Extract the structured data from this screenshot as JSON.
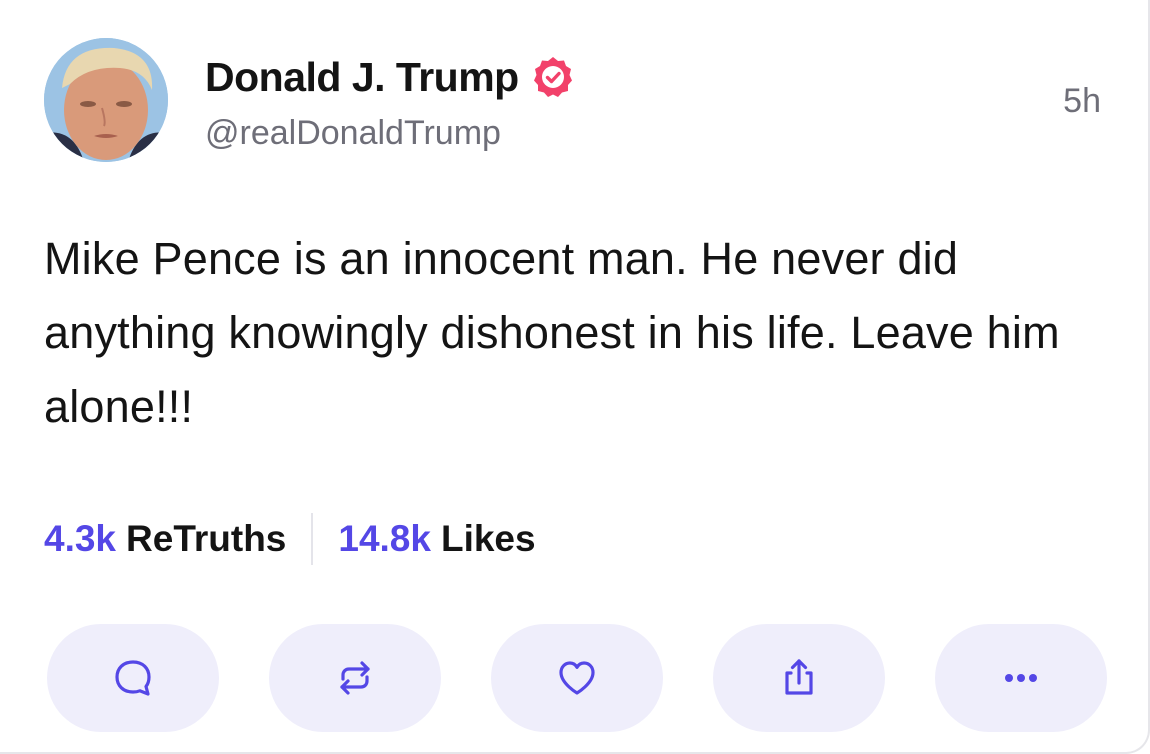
{
  "post": {
    "author": {
      "display_name": "Donald J. Trump",
      "handle": "@realDonaldTrump",
      "verified": true,
      "avatar_icon": "profile-photo"
    },
    "timestamp": "5h",
    "text": "Mike Pence is an innocent man. He never did anything knowingly dishonest in his life. Leave him alone!!!",
    "stats": {
      "retruths_count": "4.3k",
      "retruths_label": "ReTruths",
      "likes_count": "14.8k",
      "likes_label": "Likes"
    },
    "actions": [
      {
        "name": "reply",
        "icon": "speech-bubble-icon"
      },
      {
        "name": "retruth",
        "icon": "repost-arrows-icon"
      },
      {
        "name": "like",
        "icon": "heart-icon"
      },
      {
        "name": "share",
        "icon": "share-upload-icon"
      },
      {
        "name": "more",
        "icon": "ellipsis-icon"
      }
    ]
  },
  "colors": {
    "accent": "#5447e6",
    "verified_badge": "#f2416a",
    "action_bg": "#efeefb",
    "text_primary": "#141414",
    "text_secondary": "#6e6e78"
  }
}
